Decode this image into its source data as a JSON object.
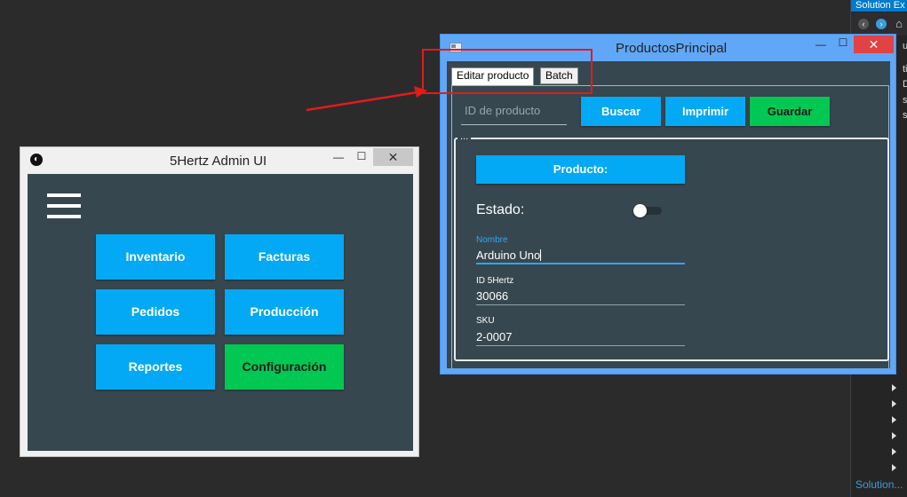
{
  "solution_explorer": {
    "title": "Solution Ex",
    "bottom_label": "Solution...",
    "fragments": [
      "u",
      "ti",
      "De",
      "s",
      "s"
    ]
  },
  "admin_window": {
    "title": "5Hertz Admin UI",
    "tiles": [
      {
        "label": "Inventario",
        "color": "#03a9f4"
      },
      {
        "label": "Facturas",
        "color": "#03a9f4"
      },
      {
        "label": "Pedidos",
        "color": "#03a9f4"
      },
      {
        "label": "Producción",
        "color": "#03a9f4"
      },
      {
        "label": "Reportes",
        "color": "#03a9f4"
      },
      {
        "label": "Configuración",
        "color": "#00c853"
      }
    ]
  },
  "product_window": {
    "title": "ProductosPrincipal",
    "tabs": [
      {
        "label": "Editar producto",
        "active": true
      },
      {
        "label": "Batch",
        "active": false
      }
    ],
    "search": {
      "placeholder": "ID de producto",
      "value": ""
    },
    "buttons": {
      "buscar": "Buscar",
      "imprimir": "Imprimir",
      "guardar": "Guardar"
    },
    "group_label": "...",
    "producto_button": "Producto:",
    "estado_label": "Estado:",
    "estado_on": false,
    "fields": {
      "nombre": {
        "label": "Nombre",
        "value": "Arduino Uno"
      },
      "id5hertz": {
        "label": "ID 5Hertz",
        "value": "30066"
      },
      "sku": {
        "label": "SKU",
        "value": "2-0007"
      }
    }
  },
  "icons": {
    "minimize": "minimize-icon",
    "maximize": "maximize-icon",
    "close": "close-icon",
    "menu": "hamburger-menu-icon"
  },
  "colors": {
    "accent_blue": "#03a9f4",
    "accent_green": "#00c853",
    "panel_dark": "#37474f",
    "annotation_red": "#e21b1b"
  },
  "glyphs": {
    "minimize": "—",
    "maximize": "☐",
    "close": "✕",
    "back": "‹",
    "forward": "›",
    "home": "⌂",
    "app": "◐"
  }
}
